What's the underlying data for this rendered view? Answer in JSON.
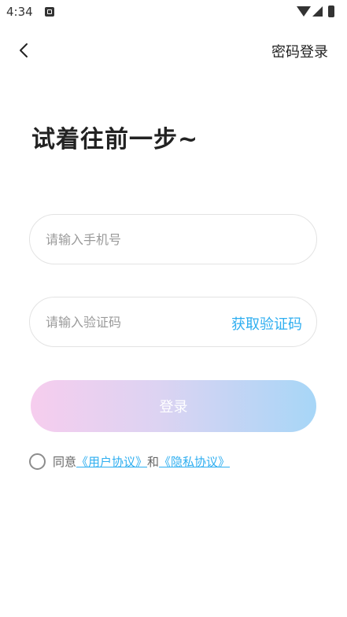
{
  "status_bar": {
    "time": "4:34",
    "icons": [
      "notification-icon",
      "wifi-icon",
      "signal-icon",
      "battery-icon"
    ]
  },
  "header": {
    "back_icon": "chevron-left-icon",
    "password_login": "密码登录"
  },
  "title": "试着往前一步~",
  "form": {
    "phone_placeholder": "请输入手机号",
    "code_placeholder": "请输入验证码",
    "get_code": "获取验证码",
    "login_button": "登录"
  },
  "agreement": {
    "prefix": "同意",
    "user_agreement": "《用户协议》",
    "conjunction": "和",
    "privacy_agreement": "《隐私协议》"
  },
  "colors": {
    "link": "#2eaef0",
    "gradient_start": "#f6cdee",
    "gradient_end": "#a7d6f7"
  }
}
